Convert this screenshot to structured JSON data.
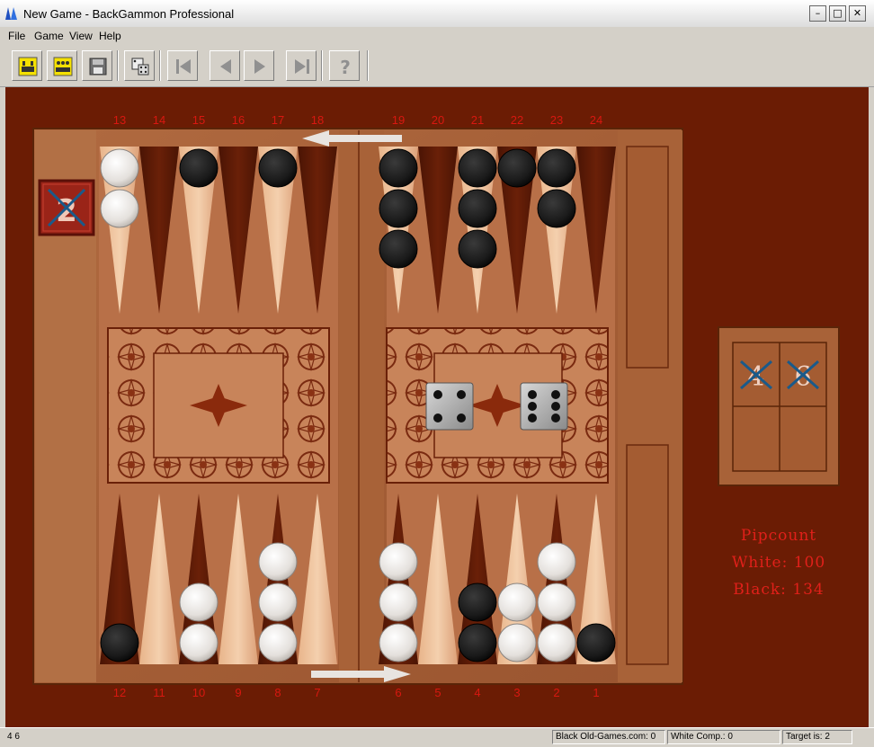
{
  "window": {
    "title": "New Game - BackGammon Professional"
  },
  "menu": {
    "items": [
      "File",
      "Game",
      "View",
      "Help"
    ]
  },
  "toolbar": {
    "buttons": [
      "new-game-icon",
      "new-match-icon",
      "save-icon",
      "roll-dice-icon",
      "first-move-icon",
      "previous-move-icon",
      "next-move-icon",
      "last-move-icon",
      "help-icon"
    ]
  },
  "board": {
    "top_numbers": [
      "13",
      "14",
      "15",
      "16",
      "17",
      "18",
      "19",
      "20",
      "21",
      "22",
      "23",
      "24"
    ],
    "bottom_numbers": [
      "12",
      "11",
      "10",
      "9",
      "8",
      "7",
      "6",
      "5",
      "4",
      "3",
      "2",
      "1"
    ],
    "doubling_cube": "2",
    "dice": [
      4,
      6
    ],
    "used_dice": [
      "4",
      "6"
    ],
    "checkers": {
      "1": {
        "color": "black",
        "count": 1
      },
      "2": {
        "color": "white",
        "count": 3
      },
      "3": {
        "color": "white",
        "count": 2
      },
      "4": {
        "color": "black",
        "count": 2
      },
      "6": {
        "color": "white",
        "count": 3
      },
      "8": {
        "color": "white",
        "count": 3
      },
      "10": {
        "color": "white",
        "count": 2
      },
      "12": {
        "color": "black",
        "count": 1
      },
      "13": {
        "color": "white",
        "count": 2
      },
      "15": {
        "color": "black",
        "count": 1
      },
      "17": {
        "color": "black",
        "count": 1
      },
      "19": {
        "color": "black",
        "count": 3
      },
      "21": {
        "color": "black",
        "count": 3
      },
      "22": {
        "color": "black",
        "count": 1
      },
      "23": {
        "color": "black",
        "count": 2
      }
    }
  },
  "pipcount": {
    "title": "Pipcount",
    "white": "White: 100",
    "black": "Black: 134"
  },
  "status": {
    "left": "4 6",
    "black_player": "Black Old-Games.com: 0",
    "white_player": "White Comp.: 0",
    "target": "Target is: 2"
  },
  "colors": {
    "background": "#6b1c04",
    "number_red": "#d81810",
    "pip_red": "#e0201a",
    "point_dark": "#5a1806",
    "point_light": "#f0c8a0"
  }
}
